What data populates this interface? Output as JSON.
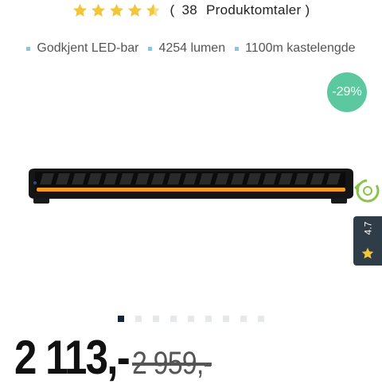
{
  "rating": {
    "stars": 4.5,
    "count": "38",
    "label": "Produktomtaler",
    "open_paren": "(",
    "close_paren": ")"
  },
  "features": [
    "Godkjent LED-bar",
    "4254 lumen",
    "1100m kastelengde"
  ],
  "discount_badge": "-29%",
  "side_badge": {
    "score": "4.7"
  },
  "gallery": {
    "slides": 9,
    "active": 0
  },
  "price": {
    "current": "2 113,-",
    "original": "2 959,-"
  },
  "colors": {
    "star": "#f3c63a",
    "discount": "#5cc8a0",
    "badge_bg": "#2f3d48",
    "bullet": "#7fc8e6",
    "led_strip": "#f39a1e"
  }
}
